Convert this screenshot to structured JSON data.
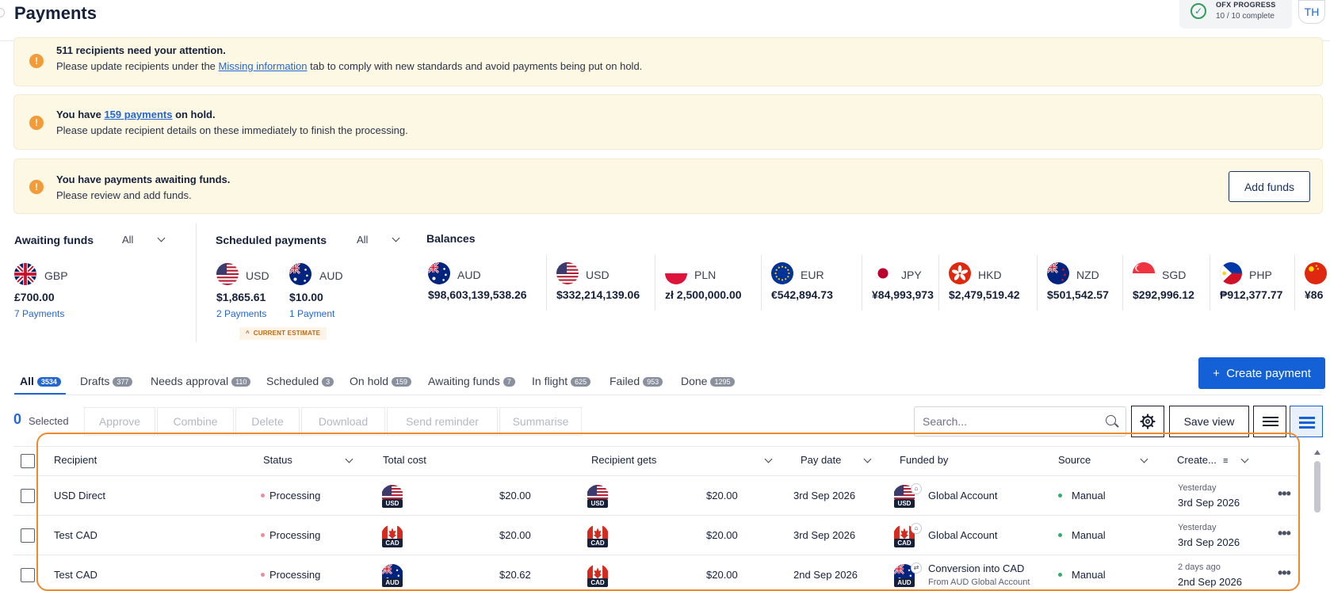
{
  "header": {
    "title": "Payments",
    "ofx_progress": {
      "label": "OFX PROGRESS",
      "status": "10 / 10 complete"
    },
    "avatar_initials": "TH"
  },
  "alerts": [
    {
      "bold": "511 recipients need your attention.",
      "pre": "Please update recipients under the ",
      "link": "Missing information",
      "post": " tab to comply with new standards and avoid payments being put on hold."
    },
    {
      "bold_pre": "You have ",
      "link": "159 payments",
      "bold_post": " on hold.",
      "text": "Please update recipient details on these immediately to finish the processing."
    },
    {
      "bold": "You have payments awaiting funds.",
      "text": "Please review and add funds.",
      "button": "Add funds"
    }
  ],
  "awaiting_funds": {
    "title": "Awaiting funds",
    "filter": "All",
    "items": [
      {
        "code": "GBP",
        "amount": "£700.00",
        "link": "7 Payments"
      }
    ]
  },
  "scheduled": {
    "title": "Scheduled payments",
    "filter": "All",
    "items": [
      {
        "code": "USD",
        "amount": "$1,865.61",
        "link": "2 Payments"
      },
      {
        "code": "AUD",
        "amount": "$10.00",
        "link": "1 Payment"
      }
    ],
    "estimate_label": "CURRENT ESTIMATE"
  },
  "balances": {
    "title": "Balances",
    "items": [
      {
        "code": "AUD",
        "amount": "$98,603,139,538.26"
      },
      {
        "code": "USD",
        "amount": "$332,214,139.06"
      },
      {
        "code": "PLN",
        "amount": "zł 2,500,000.00"
      },
      {
        "code": "EUR",
        "amount": "€542,894.73"
      },
      {
        "code": "JPY",
        "amount": "¥84,993,973"
      },
      {
        "code": "HKD",
        "amount": "$2,479,519.42"
      },
      {
        "code": "NZD",
        "amount": "$501,542.57"
      },
      {
        "code": "SGD",
        "amount": "$292,996.12"
      },
      {
        "code": "PHP",
        "amount": "₱912,377.77"
      },
      {
        "code": "",
        "amount": "¥86"
      }
    ]
  },
  "tabs": [
    {
      "label": "All",
      "count": "3534"
    },
    {
      "label": "Drafts",
      "count": "377"
    },
    {
      "label": "Needs approval",
      "count": "110"
    },
    {
      "label": "Scheduled",
      "count": "3"
    },
    {
      "label": "On hold",
      "count": "159"
    },
    {
      "label": "Awaiting funds",
      "count": "7"
    },
    {
      "label": "In flight",
      "count": "625"
    },
    {
      "label": "Failed",
      "count": "953"
    },
    {
      "label": "Done",
      "count": "1295"
    }
  ],
  "create_payment": "Create payment",
  "toolbar": {
    "selected_count": "0",
    "selected_label": "Selected",
    "actions": [
      "Approve",
      "Combine",
      "Delete",
      "Download",
      "Send reminder",
      "Summarise"
    ],
    "search_placeholder": "Search...",
    "save_view": "Save view"
  },
  "table": {
    "headers": [
      "Recipient",
      "Status",
      "Total cost",
      "Recipient gets",
      "Pay date",
      "Funded by",
      "Source",
      "Create..."
    ],
    "rows": [
      {
        "recipient": "USD Direct",
        "status": "Processing",
        "cost_cur": "USD",
        "cost": "$20.00",
        "gets_cur": "USD",
        "gets": "$20.00",
        "pay_date": "3rd Sep 2026",
        "funded_cur": "USD",
        "funded": "Global Account",
        "funded_sub": "",
        "source": "Manual",
        "created_rel": "Yesterday",
        "created": "3rd Sep 2026"
      },
      {
        "recipient": "Test CAD",
        "status": "Processing",
        "cost_cur": "CAD",
        "cost": "$20.00",
        "gets_cur": "CAD",
        "gets": "$20.00",
        "pay_date": "3rd Sep 2026",
        "funded_cur": "CAD",
        "funded": "Global Account",
        "funded_sub": "",
        "source": "Manual",
        "created_rel": "Yesterday",
        "created": "3rd Sep 2026"
      },
      {
        "recipient": "Test CAD",
        "status": "Processing",
        "cost_cur": "AUD",
        "cost": "$20.62",
        "gets_cur": "CAD",
        "gets": "$20.00",
        "pay_date": "2nd Sep 2026",
        "funded_cur": "AUD",
        "funded": "Conversion into CAD",
        "funded_sub": "From AUD Global Account",
        "source": "Manual",
        "created_rel": "2 days ago",
        "created": "2nd Sep 2026"
      }
    ]
  },
  "colors": {
    "accent": "#1460d6",
    "alert_bg": "#fdf8e4",
    "warn": "#f29b38",
    "highlight": "#ee8a2e"
  }
}
